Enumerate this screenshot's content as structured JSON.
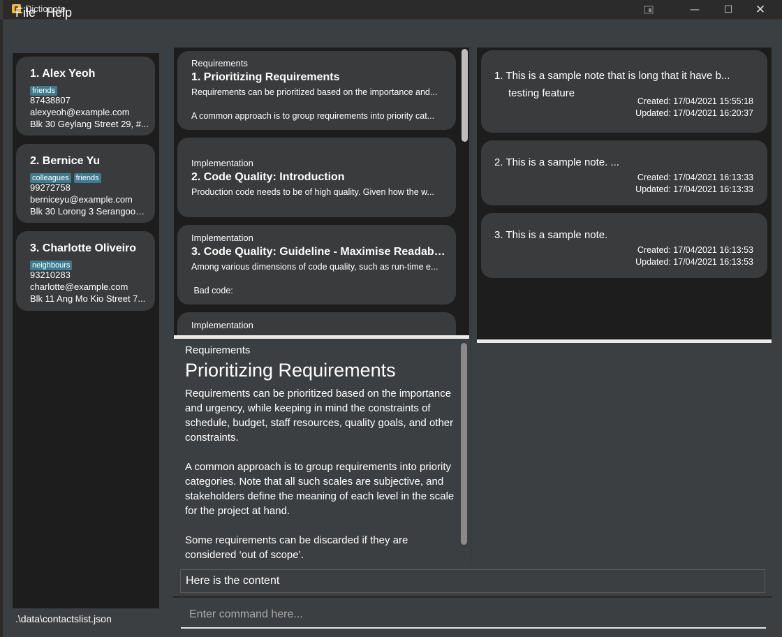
{
  "window": {
    "title": "Dictionote",
    "snap_icon": "snap-layout-icon",
    "minimize": "—",
    "maximize": "☐",
    "close": "✕"
  },
  "menu": {
    "file": "File",
    "help": "Help"
  },
  "contacts": {
    "items": [
      {
        "name": "1.  Alex Yeoh",
        "tags": [
          "friends"
        ],
        "phone": "87438807",
        "email": "alexyeoh@example.com",
        "address": "Blk 30 Geylang Street 29, #..."
      },
      {
        "name": "2.  Bernice Yu",
        "tags": [
          "colleagues",
          "friends"
        ],
        "phone": "99272758",
        "email": "berniceyu@example.com",
        "address": "Blk 30 Lorong 3 Serangoon ..."
      },
      {
        "name": "3.  Charlotte Oliveiro",
        "tags": [
          "neighbours"
        ],
        "phone": "93210283",
        "email": "charlotte@example.com",
        "address": "Blk 11 Ang Mo Kio Street 7..."
      }
    ],
    "file_path": ".\\data\\contactslist.json"
  },
  "content_list": {
    "items": [
      {
        "category": "Requirements",
        "title": "1.  Prioritizing Requirements",
        "lines": [
          "Requirements can be prioritized based on the importance and...",
          "A common approach is to group requirements into priority cat..."
        ]
      },
      {
        "category": "Implementation",
        "title": "2.  Code Quality: Introduction",
        "lines": [
          "Production code needs to be of high quality. Given how the w..."
        ]
      },
      {
        "category": "Implementation",
        "title": "3.  Code Quality: Guideline - Maximise Readabili...",
        "lines": [
          "Among various dimensions of code quality, such as run-time e...",
          " Bad code:"
        ]
      },
      {
        "category": "Implementation",
        "title": "",
        "lines": []
      }
    ]
  },
  "content_detail": {
    "category": "Requirements",
    "title": "Prioritizing Requirements",
    "paragraphs": [
      "Requirements can be prioritized based on the importance and urgency, while keeping in mind the constraints of schedule, budget, staff resources, quality goals, and other constraints.",
      "A common approach is to group requirements into priority categories. Note that all such scales are subjective, and stakeholders define the meaning of each level in the scale for the project at hand.",
      "Some requirements can be discarded if they are considered ‘out of scope’."
    ]
  },
  "notes": {
    "items": [
      {
        "title": "1.  This is a sample note that is long that it have b...",
        "title_line2": "testing feature",
        "created": "Created: 17/04/2021 15:55:18",
        "updated": "Updated: 17/04/2021 16:20:37"
      },
      {
        "title": "2.  This is a sample note. ...",
        "created": "Created: 17/04/2021 16:13:33",
        "updated": "Updated: 17/04/2021 16:13:33"
      },
      {
        "title": "3.  This is a sample note.",
        "created": "Created: 17/04/2021 16:13:53",
        "updated": "Updated: 17/04/2021 16:13:53"
      }
    ]
  },
  "result_display": {
    "text": "Here is the content"
  },
  "command": {
    "placeholder": "Enter command here..."
  }
}
